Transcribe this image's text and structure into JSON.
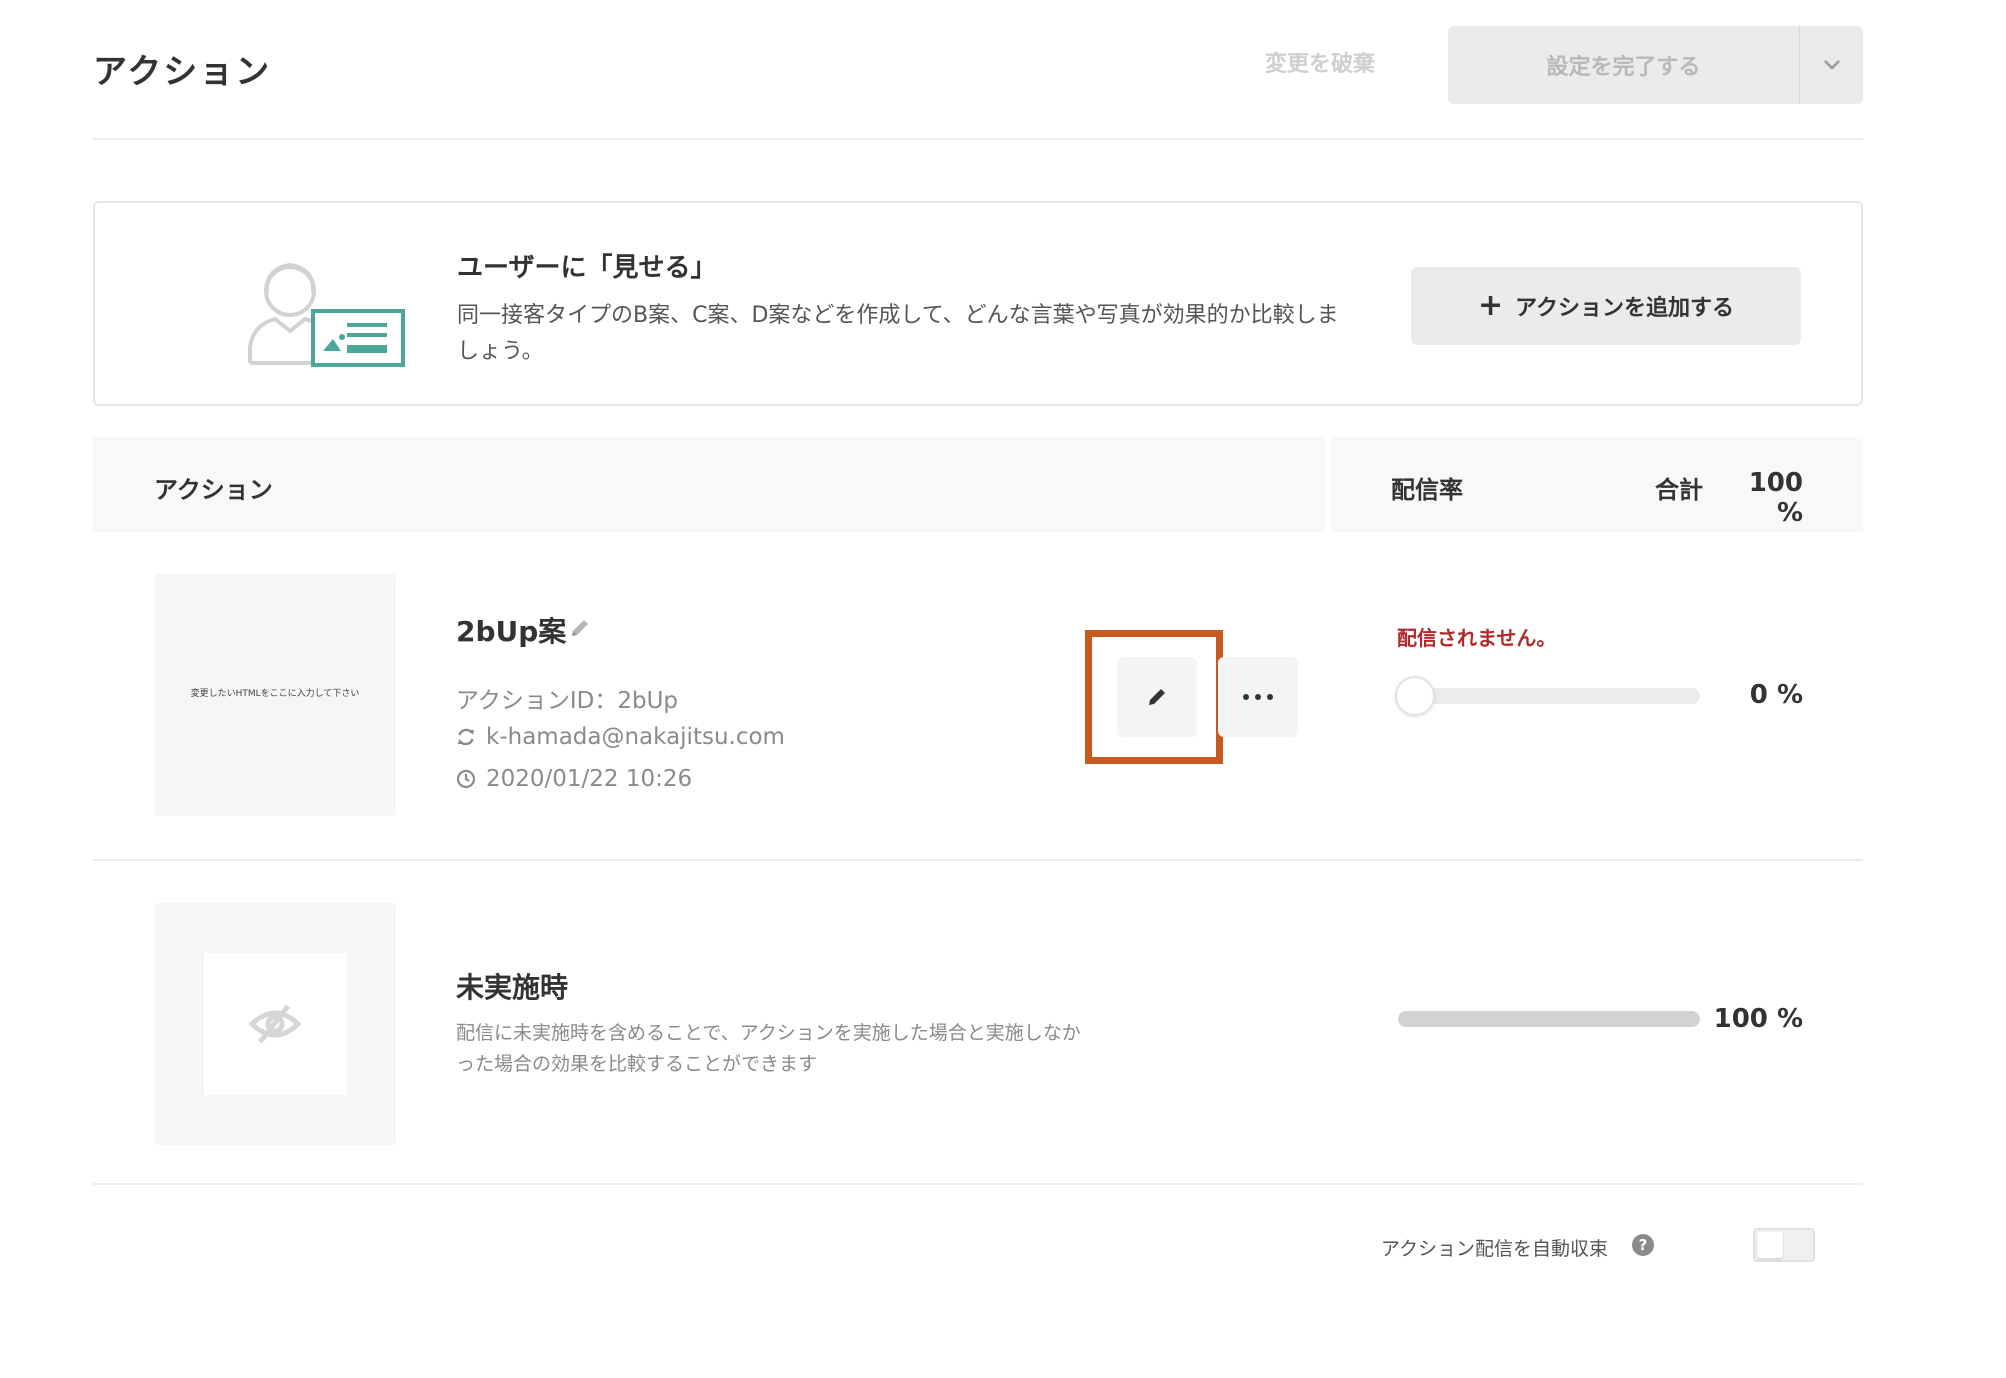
{
  "header": {
    "title": "アクション",
    "discard_label": "変更を破棄",
    "complete_label": "設定を完了する"
  },
  "info_card": {
    "title": "ユーザーに「見せる」",
    "description": "同一接客タイプのB案、C案、D案などを作成して、どんな言葉や写真が効果的か比較しましょう。",
    "add_button_label": "アクションを追加する",
    "accent_color": "#4aa79a"
  },
  "table_header": {
    "action_label": "アクション",
    "rate_label": "配信率",
    "total_label": "合計",
    "total_value": "100 %"
  },
  "rows": [
    {
      "thumbnail_text": "変更したいHTMLをここに入力して下さい",
      "name": "2bUp案",
      "action_id": "アクションID：2bUp",
      "user": "k-hamada@nakajitsu.com",
      "updated_at": "2020/01/22 10:26",
      "status": "配信されません。",
      "rate_value": "0 %",
      "rate_fraction": 0
    },
    {
      "name": "未実施時",
      "description": "配信に未実施時を含めることで、アクションを実施した場合と実施しなかった場合の効果を比較することができます",
      "rate_value": "100 %",
      "rate_fraction": 1
    }
  ],
  "footer": {
    "auto_converge_label": "アクション配信を自動収束",
    "help_glyph": "?",
    "toggle_on": false
  },
  "colors": {
    "highlight": "#c75a1f",
    "status_red": "#b02a2a"
  }
}
